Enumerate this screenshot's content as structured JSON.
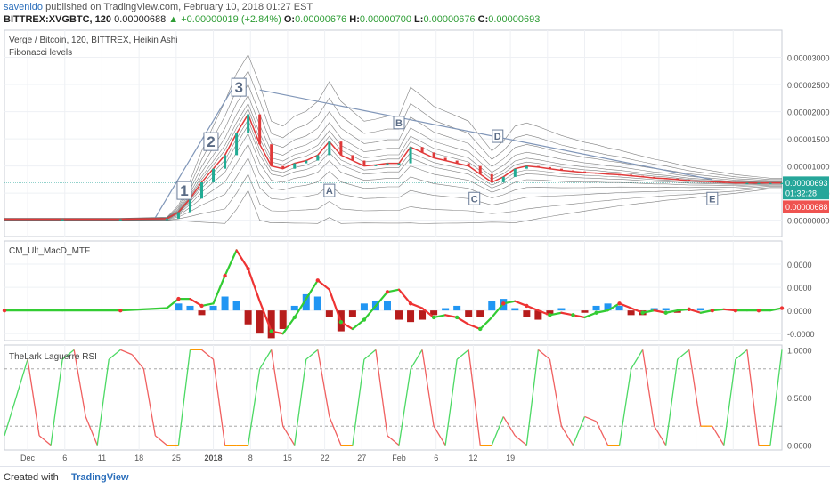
{
  "header": {
    "user": "savenido",
    "published": "published on TradingView.com, February 10, 2018 01:27 EST",
    "symbol": "BITTREX:XVGBTC, 120",
    "last": "0.00000688",
    "change": "▲ +0.00000019 (+2.84%)",
    "o_label": "O:",
    "o": "0.00000676",
    "h_label": "H:",
    "h": "0.00000700",
    "l_label": "L:",
    "l": "0.00000676",
    "c_label": "C:",
    "c": "0.00000693"
  },
  "footer": {
    "created": "Created with",
    "brand": "TradingView"
  },
  "colors": {
    "up": "#22ab94",
    "down": "#e03a3a",
    "trendline": "#8096b8",
    "macd_up": "#33cc33",
    "macd_down": "#ee3333",
    "hist_pos": "#2196f3",
    "hist_neg": "#b71c1c",
    "rsi_up": "#4cd964",
    "rsi_down": "#f06060",
    "rsi_flat": "#ff9800",
    "ribbon": "#555555"
  },
  "chart_data": [
    {
      "type": "line",
      "panel": "price",
      "title": "Verge / Bitcoin, 120, BITTREX, Heikin Ashi",
      "subtitle": "Fibonacci levels",
      "y_ticks": [
        "0.00003000",
        "0.00002500",
        "0.00002000",
        "0.00001500",
        "0.00001000",
        "0.00000500",
        "0.00000000"
      ],
      "y_tick_values": [
        3.0,
        2.5,
        2.0,
        1.5,
        1.0,
        0.5,
        0.0
      ],
      "ylim": [
        -0.3,
        3.5
      ],
      "price_tags": [
        {
          "label": "0.00000693",
          "value": 0.693,
          "color": "#26a69a"
        },
        {
          "label": "01:32:28",
          "value": 0.5,
          "color": "#26a69a"
        },
        {
          "label": "0.00000688",
          "value": 0.25,
          "color": "#ef5350"
        }
      ],
      "x": [
        0,
        5,
        10,
        14,
        15,
        16,
        17,
        18,
        19,
        20,
        21,
        22,
        23,
        24,
        25,
        26,
        27,
        28,
        29,
        30,
        31,
        32,
        33,
        34,
        35,
        36,
        37,
        38,
        39,
        40,
        41,
        42,
        43,
        44,
        45,
        46,
        47,
        48,
        49,
        50,
        51,
        52,
        53,
        54,
        55,
        56,
        57,
        58,
        59,
        60,
        61,
        62,
        63,
        64,
        65,
        66,
        67
      ],
      "close": [
        0.02,
        0.02,
        0.02,
        0.03,
        0.15,
        0.4,
        0.7,
        0.95,
        1.2,
        1.6,
        1.95,
        1.4,
        1.0,
        0.95,
        1.05,
        1.1,
        1.2,
        1.45,
        1.2,
        1.1,
        1.0,
        1.02,
        1.05,
        1.05,
        1.35,
        1.25,
        1.15,
        1.1,
        1.05,
        1.0,
        0.85,
        0.7,
        0.8,
        0.95,
        1.0,
        0.98,
        0.95,
        0.92,
        0.9,
        0.88,
        0.87,
        0.85,
        0.84,
        0.82,
        0.8,
        0.78,
        0.77,
        0.75,
        0.73,
        0.72,
        0.71,
        0.7,
        0.69,
        0.69,
        0.69,
        0.69,
        0.69
      ],
      "wave_labels": [
        {
          "label": "1",
          "x": 15.5,
          "y": 0.55
        },
        {
          "label": "2",
          "x": 17.8,
          "y": 1.45
        },
        {
          "label": "3",
          "x": 20.2,
          "y": 2.45
        },
        {
          "label": "A",
          "x": 28.0,
          "y": 0.55
        },
        {
          "label": "B",
          "x": 34.0,
          "y": 1.8
        },
        {
          "label": "C",
          "x": 40.5,
          "y": 0.4
        },
        {
          "label": "D",
          "x": 42.5,
          "y": 1.55
        },
        {
          "label": "E",
          "x": 61.0,
          "y": 0.4
        }
      ],
      "trendline": [
        [
          13,
          0.05
        ],
        [
          20,
          2.55
        ],
        [
          22,
          2.4
        ],
        [
          61,
          0.75
        ]
      ]
    },
    {
      "type": "line",
      "panel": "macd",
      "title": "CM_Ult_MacD_MTF",
      "y_ticks": [
        "0.0000",
        "0.0000",
        "0.0000",
        "-0.0000"
      ],
      "y_tick_values": [
        2.0,
        1.0,
        0.0,
        -1.0
      ],
      "ylim": [
        -1.3,
        3.0
      ],
      "x": [
        0,
        5,
        10,
        14,
        15,
        16,
        17,
        18,
        19,
        20,
        21,
        22,
        23,
        24,
        25,
        26,
        27,
        28,
        29,
        30,
        31,
        32,
        33,
        34,
        35,
        36,
        37,
        38,
        39,
        40,
        41,
        42,
        43,
        44,
        45,
        46,
        47,
        48,
        49,
        50,
        51,
        52,
        53,
        54,
        55,
        56,
        57,
        58,
        59,
        60,
        61,
        62,
        63,
        64,
        65,
        66,
        67
      ],
      "macd": [
        0,
        0,
        0,
        0.1,
        0.5,
        0.5,
        0.2,
        0.3,
        1.5,
        2.6,
        1.8,
        0.4,
        -0.9,
        -1.0,
        -0.3,
        0.5,
        1.3,
        0.9,
        -0.5,
        -0.8,
        -0.4,
        0.2,
        0.8,
        0.9,
        0.3,
        0.1,
        -0.3,
        -0.2,
        -0.3,
        -0.6,
        -0.8,
        -0.3,
        0.3,
        0.4,
        0.2,
        0.0,
        -0.2,
        -0.1,
        -0.2,
        -0.3,
        -0.1,
        0.0,
        0.3,
        0.1,
        -0.1,
        0.0,
        -0.1,
        0.0,
        0.05,
        -0.1,
        0.0,
        0.05,
        0.0,
        0.0,
        0.0,
        0.0,
        0.1
      ],
      "hist": [
        0,
        0,
        0,
        0,
        0.3,
        0.2,
        -0.2,
        0.2,
        0.6,
        0.4,
        -0.6,
        -1.0,
        -1.2,
        -0.8,
        0.2,
        0.7,
        0.6,
        -0.3,
        -0.9,
        -0.3,
        0.3,
        0.4,
        0.4,
        -0.4,
        -0.5,
        -0.4,
        -0.2,
        0.1,
        0.2,
        -0.3,
        -0.3,
        0.4,
        0.5,
        0.1,
        -0.3,
        -0.4,
        -0.2,
        0.1,
        0.0,
        -0.1,
        0.2,
        0.3,
        0.2,
        -0.2,
        -0.2,
        0.1,
        0.1,
        -0.1,
        0.05,
        0.1,
        0.0,
        0.0,
        0.0,
        0.0,
        0.0,
        0.0,
        0.0
      ]
    },
    {
      "type": "line",
      "panel": "rsi",
      "title": "TheLark Laguerre RSI",
      "y_ticks": [
        "1.0000",
        "0.5000",
        "0.0000"
      ],
      "y_tick_values": [
        1.0,
        0.5,
        0.0
      ],
      "ylim": [
        -0.05,
        1.05
      ],
      "levels": [
        0.8,
        0.2
      ],
      "x": [
        0,
        2,
        3,
        4,
        5,
        6,
        7,
        8,
        9,
        10,
        11,
        12,
        13,
        14,
        15,
        16,
        17,
        18,
        19,
        20,
        21,
        22,
        23,
        24,
        25,
        26,
        27,
        28,
        29,
        30,
        31,
        32,
        33,
        34,
        35,
        36,
        37,
        38,
        39,
        40,
        41,
        42,
        43,
        44,
        45,
        46,
        47,
        48,
        49,
        50,
        51,
        52,
        53,
        54,
        55,
        56,
        57,
        58,
        59,
        60,
        61,
        62,
        63,
        64,
        65,
        66,
        67
      ],
      "values": [
        0.1,
        0.9,
        0.1,
        0.0,
        0.9,
        1.0,
        0.3,
        0.0,
        0.9,
        1.0,
        0.95,
        0.8,
        0.1,
        0.0,
        0.0,
        1.0,
        1.0,
        0.9,
        0.0,
        0.0,
        0.0,
        0.8,
        1.0,
        0.2,
        0.0,
        0.9,
        1.0,
        0.3,
        0.0,
        0.0,
        0.9,
        1.0,
        0.1,
        0.0,
        0.8,
        1.0,
        0.2,
        0.0,
        0.9,
        1.0,
        0.0,
        0.0,
        0.3,
        0.1,
        0.0,
        1.0,
        0.9,
        0.2,
        0.0,
        0.3,
        0.25,
        0.0,
        0.0,
        0.8,
        1.0,
        0.2,
        0.0,
        0.9,
        1.0,
        0.2,
        0.2,
        0.0,
        0.9,
        1.0,
        0.0,
        0.0,
        1.0
      ]
    },
    {
      "type": "axis",
      "panel": "time",
      "x_tick_positions": [
        2,
        5.2,
        8.4,
        11.6,
        14.8,
        18,
        21.2,
        24.4,
        27.6,
        30.8,
        34,
        37.2,
        40.4,
        43.6,
        46.8,
        50,
        53.2,
        56.4,
        59.6,
        62.8
      ],
      "x_tick_labels": [
        "Dec",
        "6",
        "11",
        "18",
        "25",
        "2018",
        "8",
        "15",
        "22",
        "27",
        "Feb",
        "6",
        "12",
        "19",
        "",
        "",
        "",
        "",
        "",
        ""
      ],
      "xlim": [
        0,
        67
      ]
    }
  ]
}
